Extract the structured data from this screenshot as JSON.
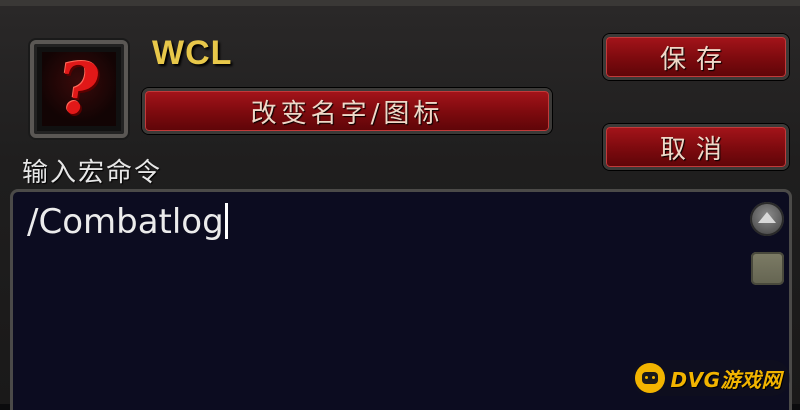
{
  "macro": {
    "name": "WCL",
    "icon": "question-mark-icon",
    "change_button_label": "改变名字/图标",
    "save_label": "保存",
    "cancel_label": "取消",
    "input_label": "输入宏命令",
    "macro_text": "/Combatlog"
  },
  "watermark": {
    "text": "DVG游戏网",
    "logo": "gamepad-logo-icon"
  },
  "colors": {
    "name_gold": "#e8c84a",
    "button_red": "#8c0e12",
    "edit_bg": "#0c0c20",
    "icon_red": "#e11818",
    "watermark_yellow": "#f2b400"
  }
}
